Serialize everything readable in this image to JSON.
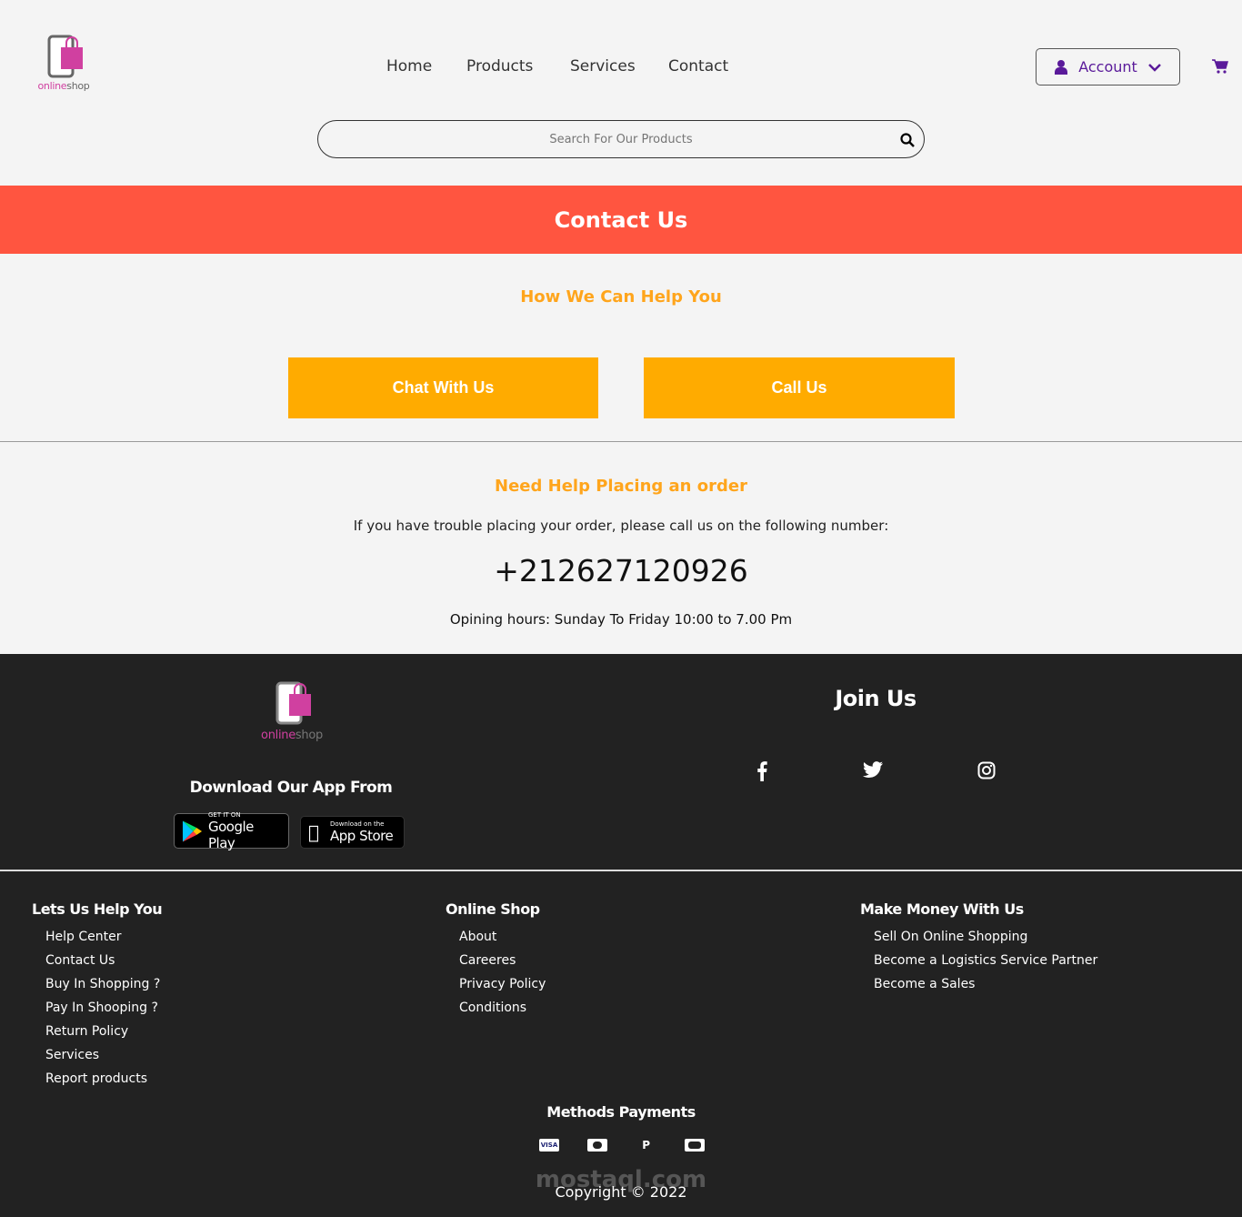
{
  "brand": {
    "logo_text_1": "online",
    "logo_text_2": "shop"
  },
  "nav": [
    {
      "label": "Home"
    },
    {
      "label": "Products"
    },
    {
      "label": "Services"
    },
    {
      "label": "Contact"
    }
  ],
  "account": {
    "label": "Account"
  },
  "search": {
    "placeholder": "Search For Our Products"
  },
  "banner": {
    "title": "Contact Us"
  },
  "help": {
    "heading": "How We Can Help You",
    "chat_label": "Chat With Us",
    "call_label": "Call Us"
  },
  "order": {
    "heading": "Need Help Placing an order",
    "text": "If you have trouble placing your order, please call us on the following number:",
    "phone": "+212627120926",
    "hours": "Opining hours: Sunday To Friday 10:00 to 7.00 Pm"
  },
  "footer": {
    "download_title": "Download Our App From",
    "google_small": "GET IT ON",
    "google_big": "Google Play",
    "apple_small": "Download on the",
    "apple_big": "App Store",
    "join_title": "Join Us",
    "columns": [
      {
        "title": "Lets Us Help You",
        "links": [
          "Help Center",
          "Contact Us",
          "Buy In Shopping ?",
          "Pay In Shooping ?",
          "Return Policy",
          "Services",
          "Report products"
        ]
      },
      {
        "title": "Online Shop",
        "links": [
          "About",
          "Careeres",
          "Privacy Policy",
          "Conditions"
        ]
      },
      {
        "title": "Make Money With Us",
        "links": [
          "Sell On Online Shopping",
          "Become a Logistics Service Partner",
          "Become a Sales"
        ]
      }
    ],
    "payments_title": "Methods Payments",
    "visa": "VISA",
    "copyright": "Copyright © 2022",
    "watermark": "mostaql.com"
  },
  "colors": {
    "banner": "#ff5540",
    "accent": "#ffab00",
    "purple": "#5a1a9a",
    "footer": "#222222"
  }
}
